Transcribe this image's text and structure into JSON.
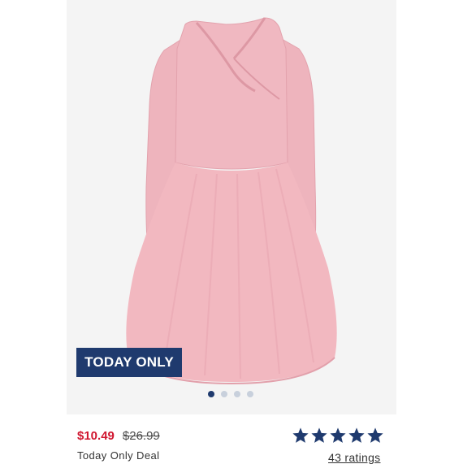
{
  "product": {
    "image_icon": "pink-tutu-dress-image",
    "badge": "TODAY ONLY",
    "carousel": {
      "count": 4,
      "active_index": 0
    },
    "sale_price": "$10.49",
    "original_price": "$26.99",
    "deal_label": "Today Only Deal",
    "rating": 5,
    "ratings_text": "43 ratings"
  },
  "colors": {
    "badge_bg": "#1f3a6e",
    "sale_price": "#d0162f",
    "star": "#1f3a6e",
    "image_bg": "#f4f4f4",
    "dress": "#eeb3bb"
  }
}
